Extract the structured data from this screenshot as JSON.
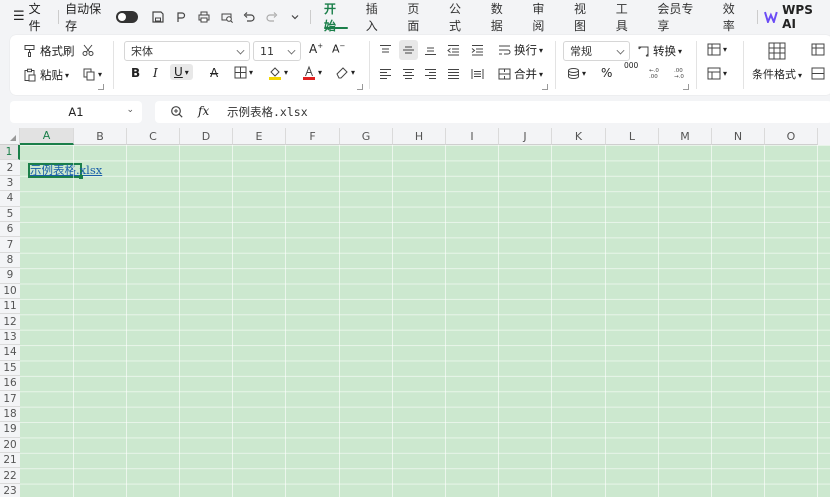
{
  "menubar": {
    "menu_label": "文件",
    "autosave_label": "自动保存",
    "tabs": [
      {
        "label": "开始",
        "active": true
      },
      {
        "label": "插入",
        "active": false
      },
      {
        "label": "页面",
        "active": false
      },
      {
        "label": "公式",
        "active": false
      },
      {
        "label": "数据",
        "active": false
      },
      {
        "label": "审阅",
        "active": false
      },
      {
        "label": "视图",
        "active": false
      },
      {
        "label": "工具",
        "active": false
      },
      {
        "label": "会员专享",
        "active": false
      },
      {
        "label": "效率",
        "active": false
      }
    ],
    "wps_ai_label": "WPS AI"
  },
  "ribbon": {
    "format_painter": "格式刷",
    "paste": "粘贴",
    "font_name": "宋体",
    "font_size": "11",
    "wrap_text": "换行",
    "merge": "合并",
    "number_format": "常规",
    "convert": "转换",
    "conditional_format": "条件格式",
    "bold": "B",
    "italic": "I",
    "underline": "U",
    "percent": "%",
    "thousands": "000"
  },
  "formula_bar": {
    "cell_ref": "A1",
    "fx": "fx",
    "content": "示例表格.xlsx"
  },
  "sheet": {
    "columns": [
      "A",
      "B",
      "C",
      "D",
      "E",
      "F",
      "G",
      "H",
      "I",
      "J",
      "K",
      "L",
      "M",
      "N",
      "O"
    ],
    "rows": [
      "1",
      "2",
      "3",
      "4",
      "5",
      "6",
      "7",
      "8",
      "9",
      "10",
      "11",
      "12",
      "13",
      "14",
      "15",
      "16",
      "17",
      "18",
      "19",
      "20",
      "21",
      "22",
      "23"
    ],
    "a1_value": "示例表格.xlsx",
    "cell_background": "#cce8cf",
    "accent": "#1b7f4a"
  }
}
